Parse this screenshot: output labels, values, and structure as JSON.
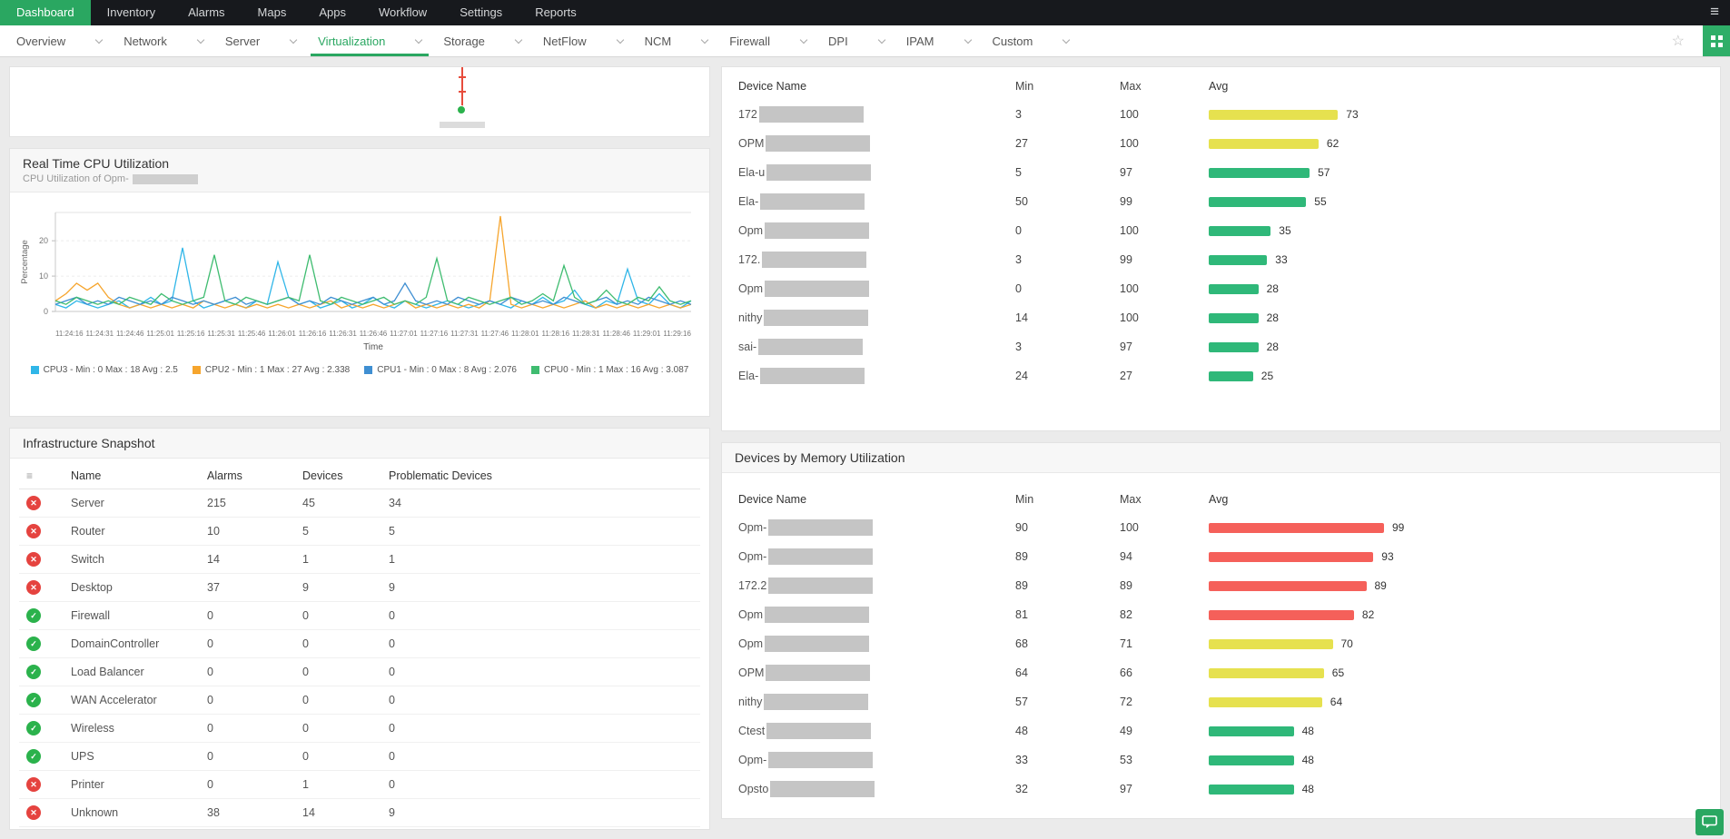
{
  "topnav": {
    "items": [
      "Dashboard",
      "Inventory",
      "Alarms",
      "Maps",
      "Apps",
      "Workflow",
      "Settings",
      "Reports"
    ],
    "active": "Dashboard"
  },
  "tabbar": {
    "tabs": [
      "Overview",
      "Network",
      "Server",
      "Virtualization",
      "Storage",
      "NetFlow",
      "NCM",
      "Firewall",
      "DPI",
      "IPAM",
      "Custom"
    ],
    "active": "Virtualization"
  },
  "icons": {
    "menu": "≡",
    "star": "☆",
    "check": "✓",
    "cross": "✕",
    "sort": "≡"
  },
  "colors": {
    "accent_green": "#2aa761",
    "bar_green": "#2fb879",
    "bar_yellow": "#e6e14f",
    "bar_red": "#f5605a",
    "status_critical": "#e5433f",
    "status_ok": "#2bb24c",
    "redacted": "#c5c5c5"
  },
  "cpu_panel": {
    "title": "Real Time CPU Utilization",
    "subtitle_prefix": "CPU Utilization of Opm-"
  },
  "chart_data": {
    "type": "line",
    "title": "Real Time CPU Utilization",
    "xlabel": "Time",
    "ylabel": "Percentage",
    "ylim": [
      0,
      28
    ],
    "yticks": [
      0,
      10,
      20
    ],
    "grid": true,
    "legend_position": "bottom",
    "xticks": [
      "11:24:16",
      "11:24:31",
      "11:24:46",
      "11:25:01",
      "11:25:16",
      "11:25:31",
      "11:25:46",
      "11:26:01",
      "11:26:16",
      "11:26:31",
      "11:26:46",
      "11:27:01",
      "11:27:16",
      "11:27:31",
      "11:27:46",
      "11:28:01",
      "11:28:16",
      "11:28:31",
      "11:28:46",
      "11:29:01",
      "11:29:16"
    ],
    "series": [
      {
        "name": "CPU3",
        "legend": "CPU3 - Min : 0 Max : 18 Avg : 2.5",
        "color": "#30b6e8",
        "values": [
          2,
          1,
          3,
          2,
          1,
          2,
          3,
          1,
          2,
          4,
          2,
          3,
          18,
          3,
          1,
          2,
          3,
          2,
          1,
          3,
          2,
          14,
          4,
          2,
          3,
          1,
          2,
          3,
          1,
          2,
          4,
          2,
          1,
          3,
          2,
          1,
          2,
          3,
          2,
          1,
          2,
          3,
          2,
          1,
          3,
          2,
          4,
          2,
          3,
          6,
          2,
          1,
          3,
          2,
          12,
          3,
          2,
          5,
          2,
          1,
          3
        ]
      },
      {
        "name": "CPU2",
        "legend": "CPU2 - Min : 1 Max : 27 Avg : 2.338",
        "color": "#f6a52d",
        "values": [
          3,
          5,
          8,
          6,
          8,
          4,
          2,
          1,
          2,
          1,
          2,
          1,
          2,
          1,
          3,
          2,
          1,
          2,
          1,
          2,
          1,
          2,
          1,
          2,
          1,
          2,
          3,
          1,
          2,
          1,
          2,
          1,
          2,
          3,
          1,
          2,
          1,
          2,
          1,
          2,
          1,
          3,
          27,
          2,
          1,
          2,
          1,
          2,
          1,
          2,
          3,
          1,
          2,
          1,
          2,
          1,
          2,
          1,
          2,
          1,
          2
        ]
      },
      {
        "name": "CPU1",
        "legend": "CPU1 - Min : 0 Max : 8 Avg : 2.076",
        "color": "#3f8fd2",
        "values": [
          2,
          3,
          4,
          2,
          3,
          2,
          4,
          3,
          2,
          3,
          2,
          4,
          3,
          2,
          3,
          2,
          3,
          4,
          2,
          3,
          2,
          3,
          4,
          2,
          3,
          2,
          4,
          3,
          2,
          3,
          4,
          2,
          3,
          8,
          3,
          2,
          3,
          2,
          4,
          3,
          2,
          3,
          2,
          4,
          3,
          2,
          3,
          2,
          4,
          3,
          2,
          3,
          4,
          2,
          3,
          2,
          4,
          3,
          2,
          3,
          2
        ]
      },
      {
        "name": "CPU0",
        "legend": "CPU0 - Min : 1 Max : 16 Avg : 3.087",
        "color": "#3fbc70",
        "values": [
          3,
          2,
          4,
          3,
          2,
          3,
          2,
          4,
          3,
          2,
          5,
          3,
          2,
          3,
          4,
          16,
          3,
          2,
          4,
          3,
          2,
          3,
          4,
          3,
          16,
          3,
          2,
          4,
          3,
          2,
          3,
          4,
          2,
          3,
          2,
          4,
          15,
          3,
          2,
          4,
          3,
          2,
          3,
          4,
          2,
          3,
          5,
          3,
          13,
          4,
          2,
          3,
          6,
          3,
          2,
          4,
          3,
          7,
          3,
          2,
          3
        ]
      }
    ]
  },
  "infra_panel": {
    "title": "Infrastructure Snapshot",
    "columns": [
      "Name",
      "Alarms",
      "Devices",
      "Problematic Devices"
    ],
    "rows": [
      {
        "status": "critical",
        "name": "Server",
        "alarms": 215,
        "devices": 45,
        "problematic": 34
      },
      {
        "status": "critical",
        "name": "Router",
        "alarms": 10,
        "devices": 5,
        "problematic": 5
      },
      {
        "status": "critical",
        "name": "Switch",
        "alarms": 14,
        "devices": 1,
        "problematic": 1
      },
      {
        "status": "critical",
        "name": "Desktop",
        "alarms": 37,
        "devices": 9,
        "problematic": 9
      },
      {
        "status": "ok",
        "name": "Firewall",
        "alarms": 0,
        "devices": 0,
        "problematic": 0
      },
      {
        "status": "ok",
        "name": "DomainController",
        "alarms": 0,
        "devices": 0,
        "problematic": 0
      },
      {
        "status": "ok",
        "name": "Load Balancer",
        "alarms": 0,
        "devices": 0,
        "problematic": 0
      },
      {
        "status": "ok",
        "name": "WAN Accelerator",
        "alarms": 0,
        "devices": 0,
        "problematic": 0
      },
      {
        "status": "ok",
        "name": "Wireless",
        "alarms": 0,
        "devices": 0,
        "problematic": 0
      },
      {
        "status": "ok",
        "name": "UPS",
        "alarms": 0,
        "devices": 0,
        "problematic": 0
      },
      {
        "status": "critical",
        "name": "Printer",
        "alarms": 0,
        "devices": 1,
        "problematic": 0
      },
      {
        "status": "critical",
        "name": "Unknown",
        "alarms": 38,
        "devices": 14,
        "problematic": 9
      }
    ]
  },
  "devices_cpu_panel": {
    "columns": [
      "Device Name",
      "Min",
      "Max",
      "Avg"
    ],
    "rows": [
      {
        "prefix": "172",
        "min": 3,
        "max": 100,
        "avg": 73,
        "color": "bar_yellow"
      },
      {
        "prefix": "OPM",
        "min": 27,
        "max": 100,
        "avg": 62,
        "color": "bar_yellow"
      },
      {
        "prefix": "Ela-u",
        "min": 5,
        "max": 97,
        "avg": 57,
        "color": "bar_green"
      },
      {
        "prefix": "Ela-",
        "min": 50,
        "max": 99,
        "avg": 55,
        "color": "bar_green"
      },
      {
        "prefix": "Opm",
        "min": 0,
        "max": 100,
        "avg": 35,
        "color": "bar_green"
      },
      {
        "prefix": "172.",
        "min": 3,
        "max": 99,
        "avg": 33,
        "color": "bar_green"
      },
      {
        "prefix": "Opm",
        "min": 0,
        "max": 100,
        "avg": 28,
        "color": "bar_green"
      },
      {
        "prefix": "nithy",
        "min": 14,
        "max": 100,
        "avg": 28,
        "color": "bar_green"
      },
      {
        "prefix": "sai-",
        "min": 3,
        "max": 97,
        "avg": 28,
        "color": "bar_green"
      },
      {
        "prefix": "Ela-",
        "min": 24,
        "max": 27,
        "avg": 25,
        "color": "bar_green"
      }
    ]
  },
  "devices_mem_panel": {
    "title": "Devices by Memory Utilization",
    "columns": [
      "Device Name",
      "Min",
      "Max",
      "Avg"
    ],
    "rows": [
      {
        "prefix": "Opm-",
        "min": 90,
        "max": 100,
        "avg": 99,
        "color": "bar_red"
      },
      {
        "prefix": "Opm-",
        "min": 89,
        "max": 94,
        "avg": 93,
        "color": "bar_red"
      },
      {
        "prefix": "172.2",
        "min": 89,
        "max": 89,
        "avg": 89,
        "color": "bar_red"
      },
      {
        "prefix": "Opm",
        "min": 81,
        "max": 82,
        "avg": 82,
        "color": "bar_red"
      },
      {
        "prefix": "Opm",
        "min": 68,
        "max": 71,
        "avg": 70,
        "color": "bar_yellow"
      },
      {
        "prefix": "OPM",
        "min": 64,
        "max": 66,
        "avg": 65,
        "color": "bar_yellow"
      },
      {
        "prefix": "nithy",
        "min": 57,
        "max": 72,
        "avg": 64,
        "color": "bar_yellow"
      },
      {
        "prefix": "Ctest",
        "min": 48,
        "max": 49,
        "avg": 48,
        "color": "bar_green"
      },
      {
        "prefix": "Opm-",
        "min": 33,
        "max": 53,
        "avg": 48,
        "color": "bar_green"
      },
      {
        "prefix": "Opsto",
        "min": 32,
        "max": 97,
        "avg": 48,
        "color": "bar_green"
      }
    ]
  }
}
